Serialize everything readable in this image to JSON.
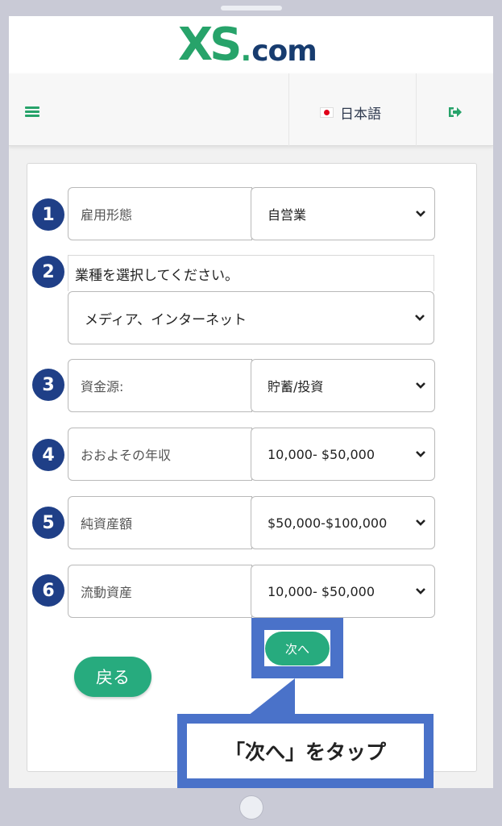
{
  "brand": {
    "logo_xs": "XS",
    "logo_dot": ".",
    "logo_com": "com"
  },
  "nav": {
    "language_label": "日本語",
    "menu_icon": "hamburger-icon",
    "logout_icon": "logout-icon"
  },
  "form": {
    "rows": [
      {
        "num": "1",
        "label": "雇用形態",
        "value": "自営業"
      },
      {
        "num": "2",
        "question": "業種を選択してください。",
        "value": "メディア、インターネット"
      },
      {
        "num": "3",
        "label": "資金源:",
        "value": "貯蓄/投資"
      },
      {
        "num": "4",
        "label": "おおよその年収",
        "value": "10,000- $50,000"
      },
      {
        "num": "5",
        "label": "純資産額",
        "value": "$50,000-$100,000"
      },
      {
        "num": "6",
        "label": "流動資産",
        "value": "10,000- $50,000"
      }
    ],
    "next_label": "次へ",
    "back_label": "戻る"
  },
  "annotation": {
    "callout_text": "「次へ」をタップ"
  },
  "colors": {
    "accent_green": "#27ab7e",
    "brand_navy": "#173c6f",
    "badge_navy": "#1f3f87",
    "highlight_blue": "#4a72c9"
  }
}
